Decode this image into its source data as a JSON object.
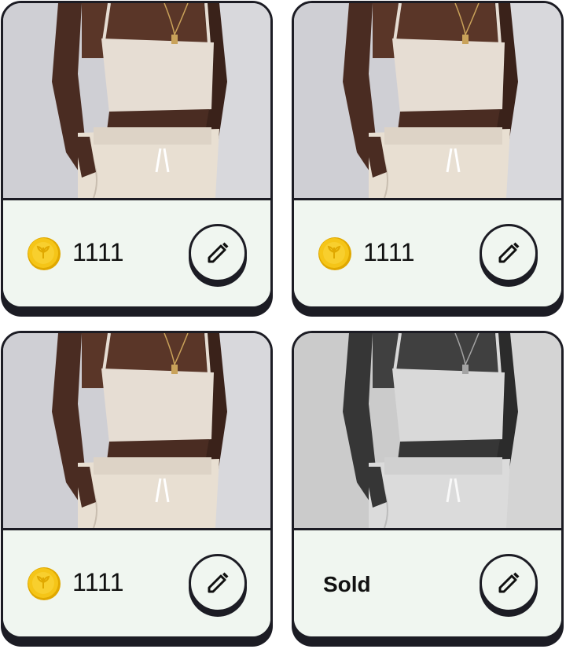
{
  "cards": [
    {
      "price": "1111",
      "status": "",
      "image": "product-photo",
      "currency_icon": "coin-icon",
      "action_icon": "pencil-icon"
    },
    {
      "price": "1111",
      "status": "",
      "image": "product-photo",
      "currency_icon": "coin-icon",
      "action_icon": "pencil-icon"
    },
    {
      "price": "1111",
      "status": "",
      "image": "product-photo",
      "currency_icon": "coin-icon",
      "action_icon": "pencil-icon"
    },
    {
      "price": "",
      "status": "Sold",
      "image": "product-photo-grayscale",
      "action_icon": "pencil-icon"
    }
  ],
  "colors": {
    "card_background": "#f0f6f0",
    "border": "#1c1c24",
    "coin": "#f5c518",
    "text": "#111111"
  }
}
